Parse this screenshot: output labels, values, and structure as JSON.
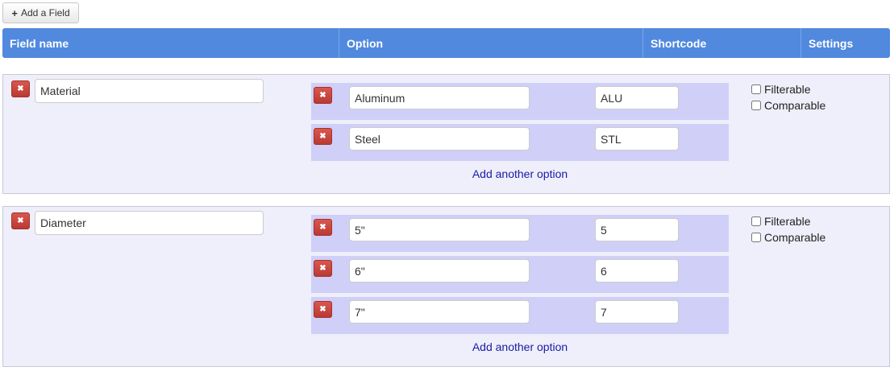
{
  "toolbar": {
    "add_field_label": "Add a Field",
    "add_field_icon": "plus-icon"
  },
  "header": {
    "columns": [
      "Field name",
      "Option",
      "Shortcode",
      "Settings"
    ],
    "color": "#5189de"
  },
  "fields": [
    {
      "name": "Material",
      "options": [
        {
          "option": "Aluminum",
          "shortcode": "ALU"
        },
        {
          "option": "Steel",
          "shortcode": "STL"
        }
      ],
      "add_option_label": "Add another option",
      "settings": [
        {
          "label": "Filterable",
          "checked": false
        },
        {
          "label": "Comparable",
          "checked": false
        }
      ]
    },
    {
      "name": "Diameter",
      "options": [
        {
          "option": "5\"",
          "shortcode": "5"
        },
        {
          "option": "6\"",
          "shortcode": "6"
        },
        {
          "option": "7\"",
          "shortcode": "7"
        }
      ],
      "add_option_label": "Add another option",
      "settings": [
        {
          "label": "Filterable",
          "checked": false
        },
        {
          "label": "Comparable",
          "checked": false
        }
      ]
    }
  ],
  "colors": {
    "delete_button": "#c9453e",
    "option_row_bg": "#cfcff8",
    "group_bg": "#efeffb",
    "link": "#1a1aa6"
  }
}
